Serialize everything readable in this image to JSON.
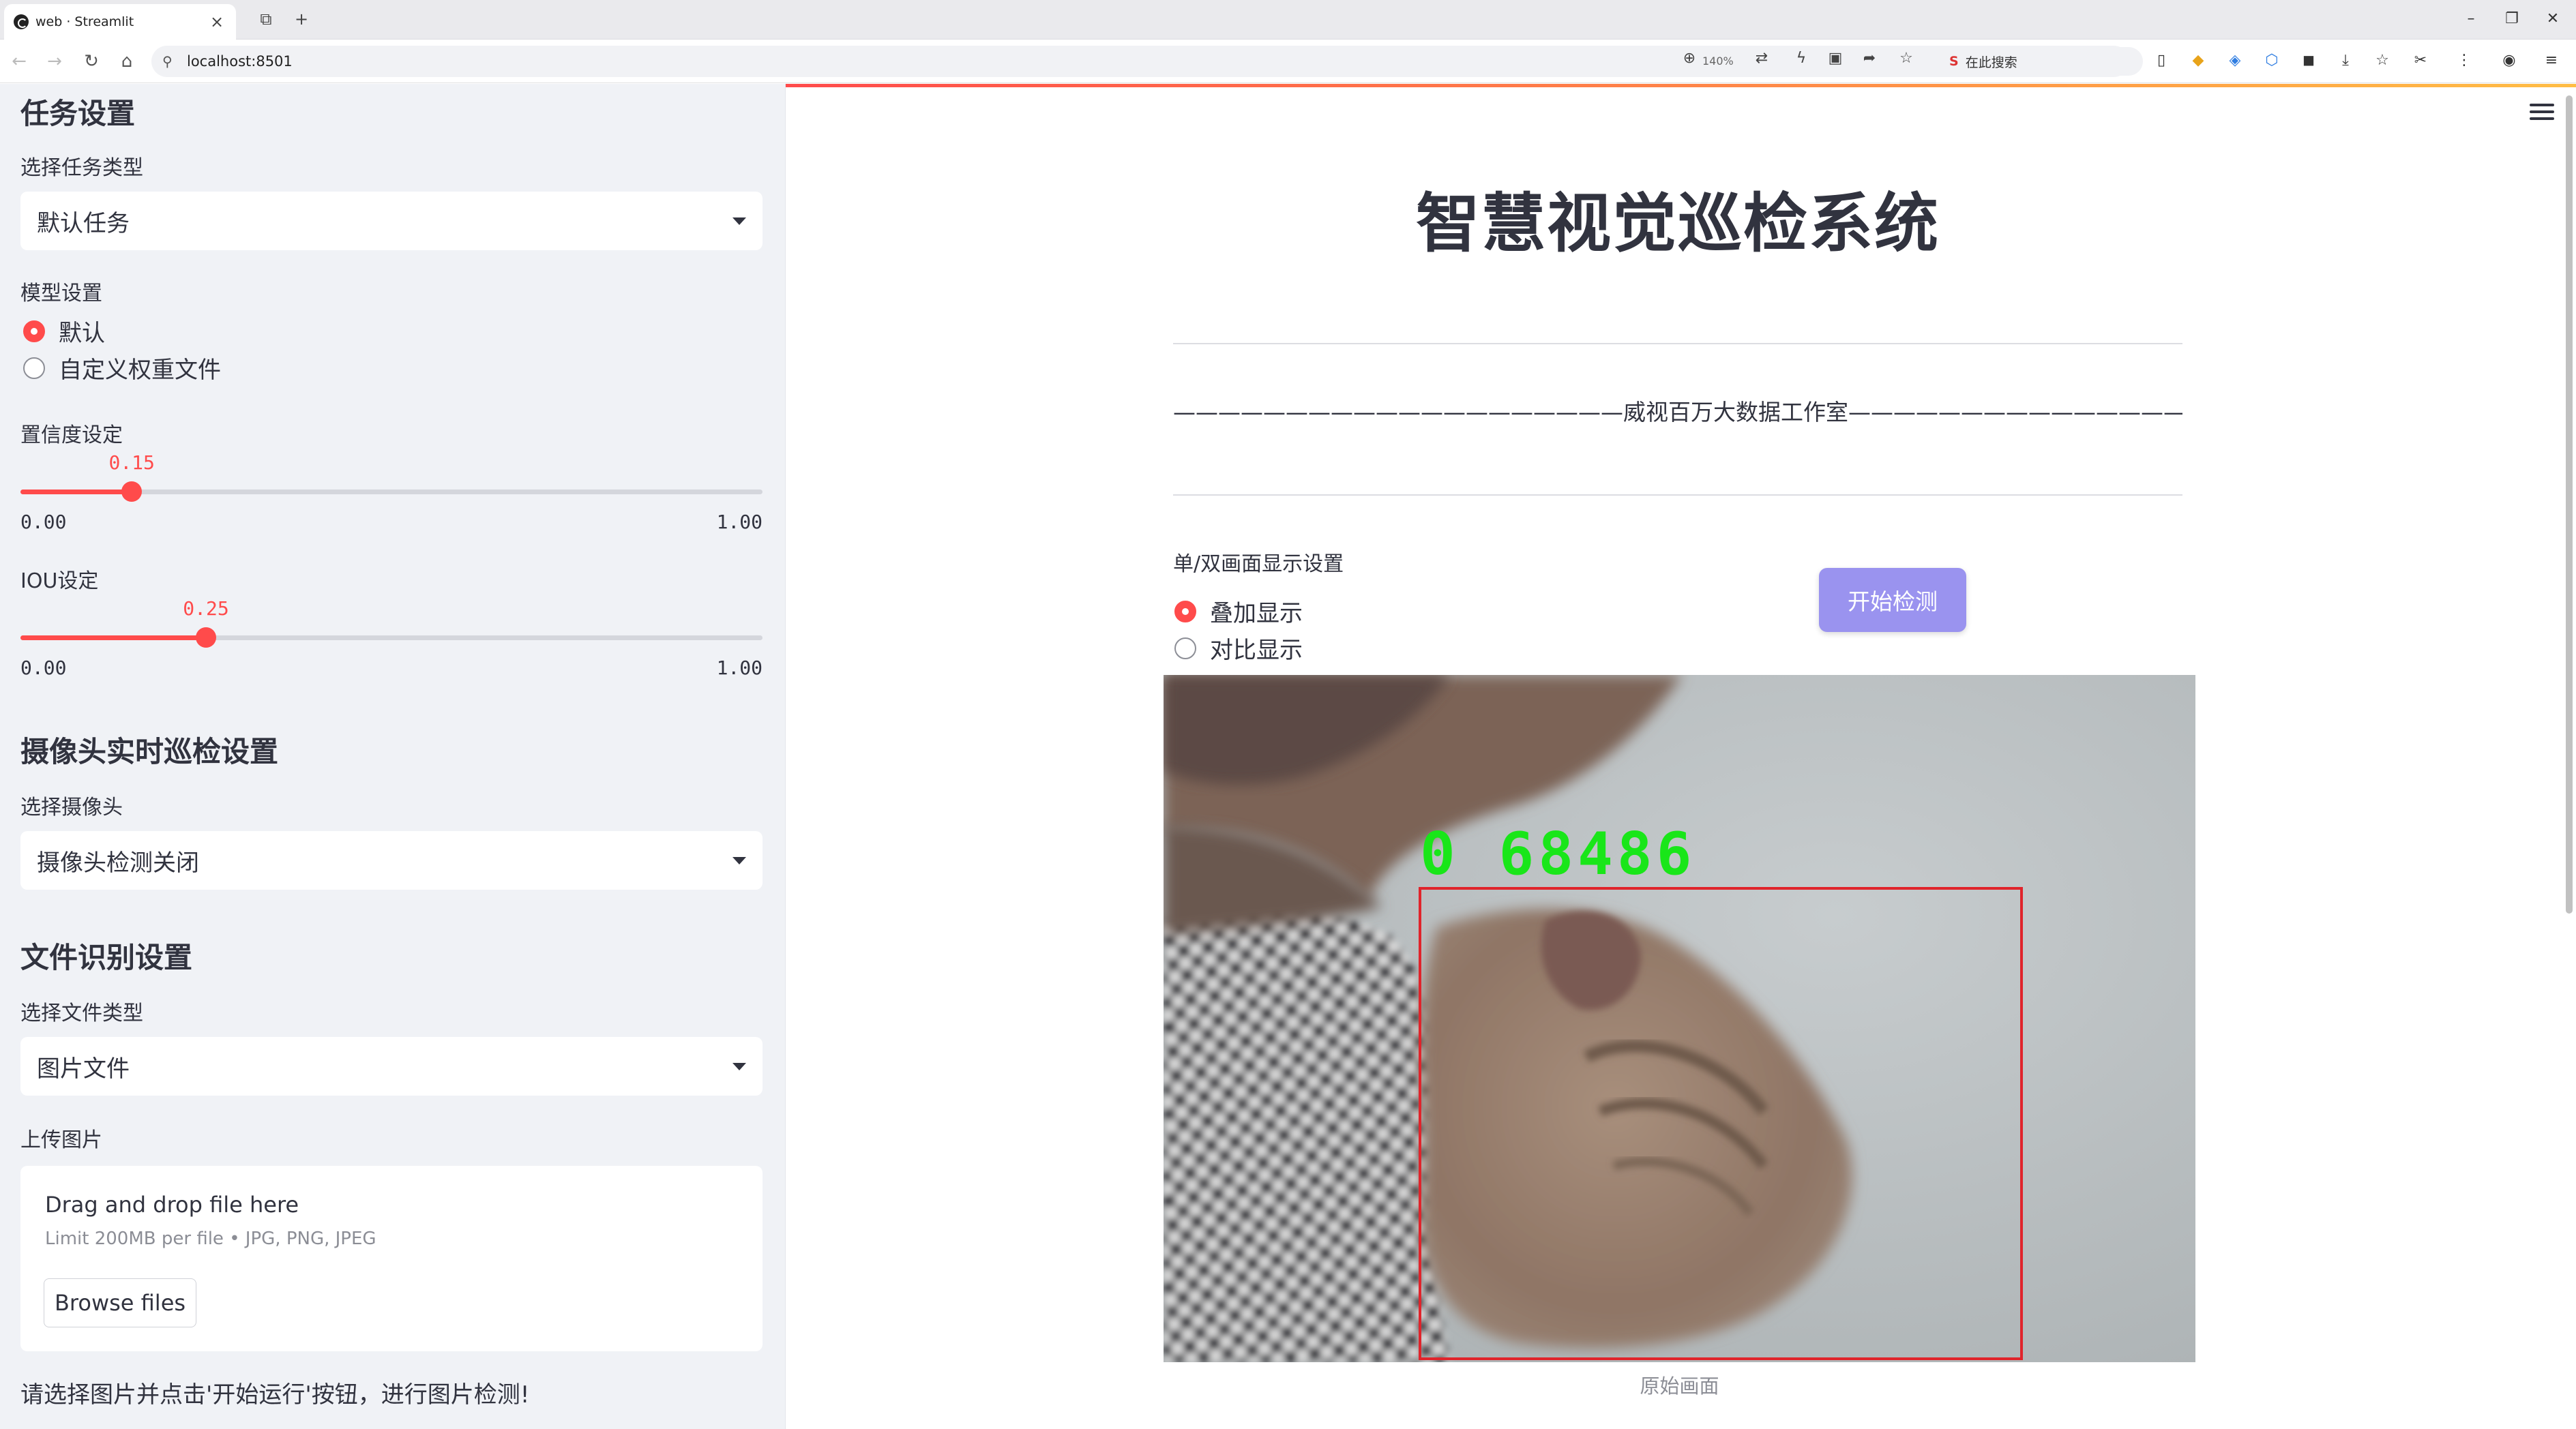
{
  "browser": {
    "tab_title": "web · Streamlit",
    "url": "localhost:8501",
    "zoom": "140%",
    "search_placeholder": "在此搜索"
  },
  "sidebar": {
    "task_header": "任务设置",
    "task_type_label": "选择任务类型",
    "task_type_value": "默认任务",
    "model_label": "模型设置",
    "model_options": [
      "默认",
      "自定义权重文件"
    ],
    "model_selected": 0,
    "confidence": {
      "label": "置信度设定",
      "value": "0.15",
      "min": "0.00",
      "max": "1.00",
      "fraction": 0.15
    },
    "iou": {
      "label": "IOU设定",
      "value": "0.25",
      "min": "0.00",
      "max": "1.00",
      "fraction": 0.25
    },
    "camera_header": "摄像头实时巡检设置",
    "camera_label": "选择摄像头",
    "camera_value": "摄像头检测关闭",
    "file_header": "文件识别设置",
    "file_type_label": "选择文件类型",
    "file_type_value": "图片文件",
    "upload_label": "上传图片",
    "upload": {
      "title": "Drag and drop file here",
      "limit": "Limit 200MB per file • JPG, PNG, JPEG",
      "browse": "Browse files"
    },
    "hint": "请选择图片并点击'开始运行'按钮，进行图片检测!"
  },
  "main": {
    "title": "智慧视觉巡检系统",
    "subtitle": "————————————————————威视百万大数据工作室—————————————————————",
    "display_label": "单/双画面显示设置",
    "display_options": [
      "叠加显示",
      "对比显示"
    ],
    "display_selected": 0,
    "start_button": "开始检测",
    "detection_label": "0 68486",
    "detection_box_color": "#e0242b",
    "detection_label_color": "#19e619",
    "image_caption": "原始画面"
  },
  "colors": {
    "accent": "#ff4b4b",
    "button": "#9a93ef",
    "sidebar_bg": "#f0f2f6"
  }
}
